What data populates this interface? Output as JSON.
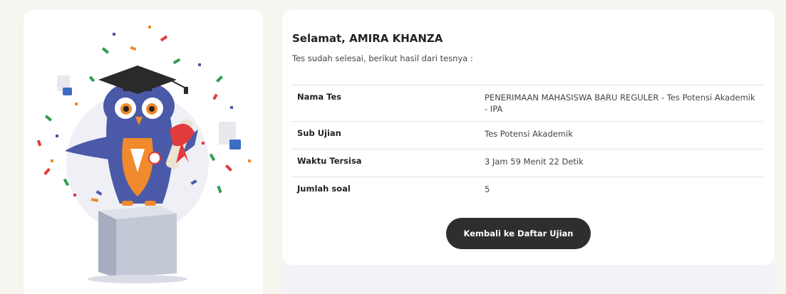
{
  "greeting": "Selamat, AMIRA KHANZA",
  "subtitle": "Tes sudah selesai, berikut hasil dari tesnya :",
  "rows": [
    {
      "label": "Nama Tes",
      "value": "PENERIMAAN MAHASISWA BARU REGULER - Tes Potensi Akademik - IPA"
    },
    {
      "label": "Sub Ujian",
      "value": "Tes Potensi Akademik"
    },
    {
      "label": "Waktu Tersisa",
      "value": "3 Jam 59 Menit 22 Detik"
    },
    {
      "label": "Jumlah soal",
      "value": "5"
    }
  ],
  "back_button_label": "Kembali ke Daftar Ujian",
  "illustration": {
    "icon": "graduation-owl-mascot-icon",
    "colors": {
      "owl_body": "#4a5aa8",
      "owl_belly": "#f08a2c",
      "cap": "#2a2a2a",
      "pedestal": "#b9bfcf",
      "ribbon": "#e23b3b"
    }
  }
}
